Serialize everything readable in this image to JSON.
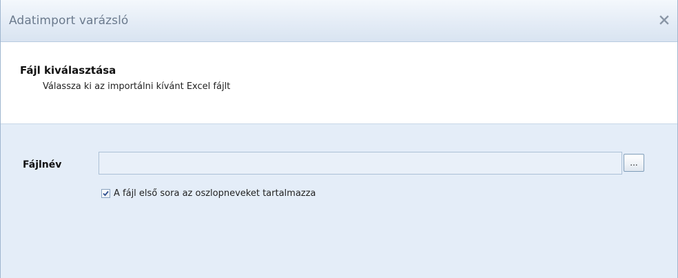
{
  "window": {
    "title": "Adatimport varázsló",
    "close_icon": "close-icon"
  },
  "header": {
    "step_title": "Fájl kiválasztása",
    "step_description": "Válassza ki az importálni kívánt Excel fájlt"
  },
  "form": {
    "file_label": "Fájlnév",
    "file_value": "",
    "browse_label": "...",
    "first_row_checkbox": {
      "checked": true,
      "label": "A fájl első sora az oszlopneveket tartalmazza"
    }
  },
  "colors": {
    "title_text": "#6b7a8d",
    "content_background": "#e4edf8",
    "header_background": "#ffffff",
    "check_mark": "#2f4f8f"
  }
}
